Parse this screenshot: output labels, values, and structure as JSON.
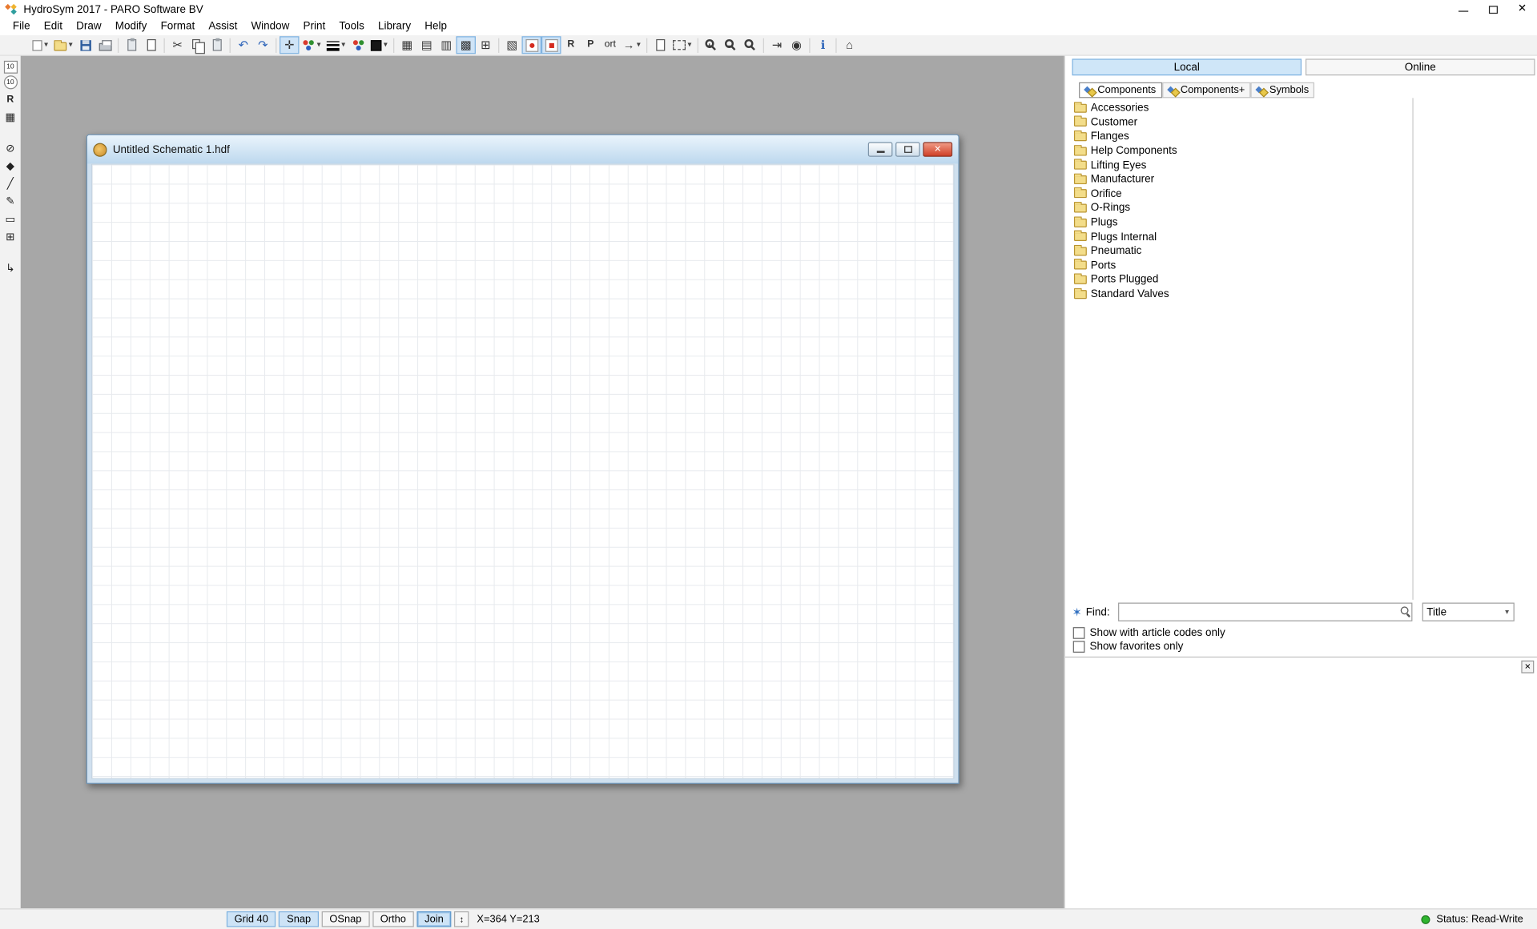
{
  "app": {
    "title": "HydroSym 2017 - PARO Software BV"
  },
  "menu": {
    "items": [
      "File",
      "Edit",
      "Draw",
      "Modify",
      "Format",
      "Assist",
      "Window",
      "Print",
      "Tools",
      "Library",
      "Help"
    ]
  },
  "toolbar": {
    "ort_label": "ort"
  },
  "document": {
    "title": "Untitled Schematic 1.hdf"
  },
  "panel": {
    "tabs": {
      "local": "Local",
      "online": "Online"
    },
    "subtabs": [
      "Components",
      "Components+",
      "Symbols"
    ],
    "folders": [
      "Accessories",
      "Customer",
      "Flanges",
      "Help Components",
      "Lifting Eyes",
      "Manufacturer",
      "Orifice",
      "O-Rings",
      "Plugs",
      "Plugs Internal",
      "Pneumatic",
      "Ports",
      "Ports Plugged",
      "Standard Valves"
    ],
    "find": {
      "label": "Find:",
      "value": "",
      "filter": "Title"
    },
    "options": [
      "Show with article codes only",
      "Show favorites only"
    ]
  },
  "statusbar": {
    "buttons": [
      "Grid 40",
      "Snap",
      "OSnap",
      "Ortho",
      "Join"
    ],
    "coordinates": "X=364 Y=213",
    "status": "Status: Read-Write"
  },
  "colors": {
    "selection_blue": "#cde3f6",
    "selection_border": "#7fb2e0",
    "status_green": "#2fb52f",
    "close_red": "#cf4028",
    "canvas_gray": "#a7a7a7",
    "folder_yellow": "#f3dd8a"
  },
  "icons": {
    "dropdown": "▾",
    "cut": "✂",
    "undo": "↶",
    "redo": "↷",
    "move": "✛",
    "grid1": "▦",
    "grid2": "▤",
    "grid3": "▥",
    "grid4": "▩",
    "grid5": "⊞",
    "hatch": "▧",
    "arrow": "→",
    "export": "⇥",
    "eye": "◉",
    "info": "ℹ",
    "library": "⌂",
    "close": "✕",
    "star": "✶",
    "updown": "↕",
    "slash": "╱",
    "pencil": "✎",
    "diamond": "◆",
    "rect": "▭",
    "route": "↳",
    "nozzle": "⊘",
    "letter_r": "R",
    "letter_p": "P",
    "badge10": "10"
  }
}
